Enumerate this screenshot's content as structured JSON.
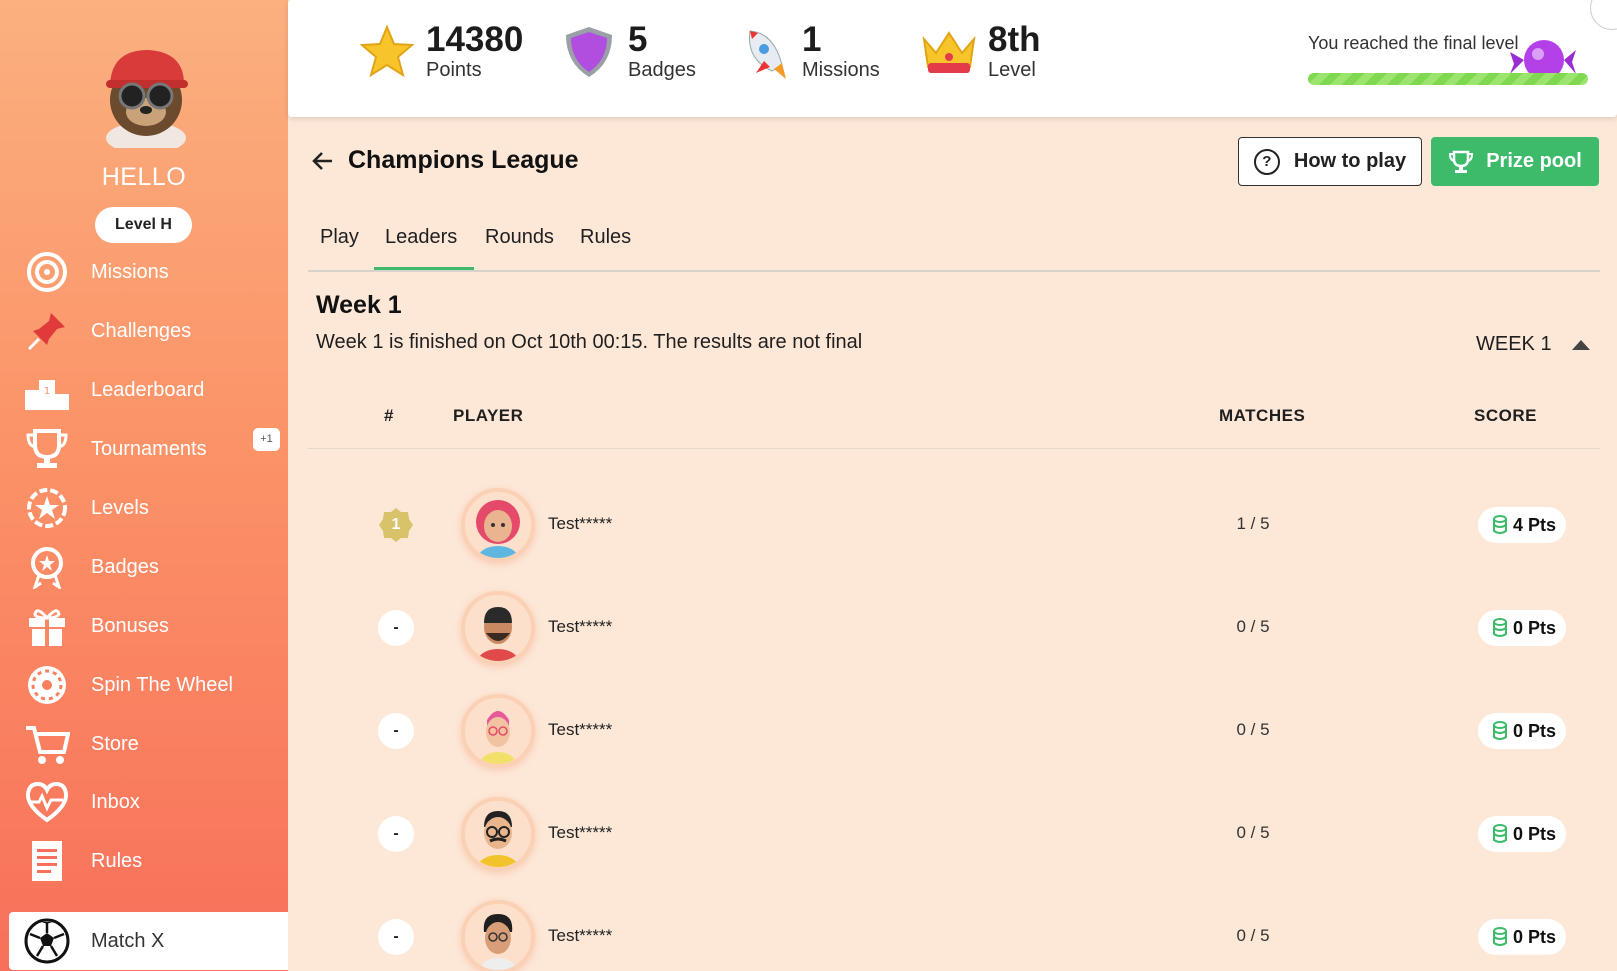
{
  "sidebar": {
    "greeting": "HELLO",
    "level": "Level H",
    "items": [
      {
        "label": "Missions",
        "icon": "target-icon"
      },
      {
        "label": "Challenges",
        "icon": "pin-icon"
      },
      {
        "label": "Leaderboard",
        "icon": "podium-icon"
      },
      {
        "label": "Tournaments",
        "icon": "trophy-icon",
        "badge": "+1"
      },
      {
        "label": "Levels",
        "icon": "star-badge-icon"
      },
      {
        "label": "Badges",
        "icon": "award-icon"
      },
      {
        "label": "Bonuses",
        "icon": "gift-icon"
      },
      {
        "label": "Spin The Wheel",
        "icon": "wheel-icon"
      },
      {
        "label": "Store",
        "icon": "cart-icon"
      },
      {
        "label": "Inbox",
        "icon": "heartbeat-icon"
      },
      {
        "label": "Rules",
        "icon": "document-icon"
      },
      {
        "label": "Match X",
        "icon": "soccer-ball-icon",
        "active": true
      }
    ]
  },
  "stats": {
    "points": {
      "value": "14380",
      "label": "Points"
    },
    "badges": {
      "value": "5",
      "label": "Badges"
    },
    "missions": {
      "value": "1",
      "label": "Missions"
    },
    "level": {
      "value": "8th",
      "label": "Level"
    },
    "final_text": "You reached the final level",
    "final_progress": 1.0
  },
  "page": {
    "title": "Champions League",
    "how_to_play": "How to play",
    "prize_pool": "Prize pool",
    "tabs": [
      "Play",
      "Leaders",
      "Rounds",
      "Rules"
    ],
    "active_tab": "Leaders",
    "week_title": "Week 1",
    "week_subtitle": "Week 1 is finished on Oct 10th 00:15. The results are not final",
    "week_select": "WEEK 1"
  },
  "table": {
    "headers": {
      "rank": "#",
      "player": "PLAYER",
      "matches": "MATCHES",
      "score": "SCORE"
    },
    "rows": [
      {
        "rank": "1",
        "name": "Test*****",
        "matches": "1 / 5",
        "score": "4 Pts"
      },
      {
        "rank": "-",
        "name": "Test*****",
        "matches": "0 / 5",
        "score": "0 Pts"
      },
      {
        "rank": "-",
        "name": "Test*****",
        "matches": "0 / 5",
        "score": "0 Pts"
      },
      {
        "rank": "-",
        "name": "Test*****",
        "matches": "0 / 5",
        "score": "0 Pts"
      },
      {
        "rank": "-",
        "name": "Test*****",
        "matches": "0 / 5",
        "score": "0 Pts"
      }
    ]
  },
  "colors": {
    "accent": "#3dbb6b",
    "sidebar_top": "#fbb07f",
    "sidebar_bottom": "#f8705a",
    "page_bg": "#fde8d8"
  }
}
